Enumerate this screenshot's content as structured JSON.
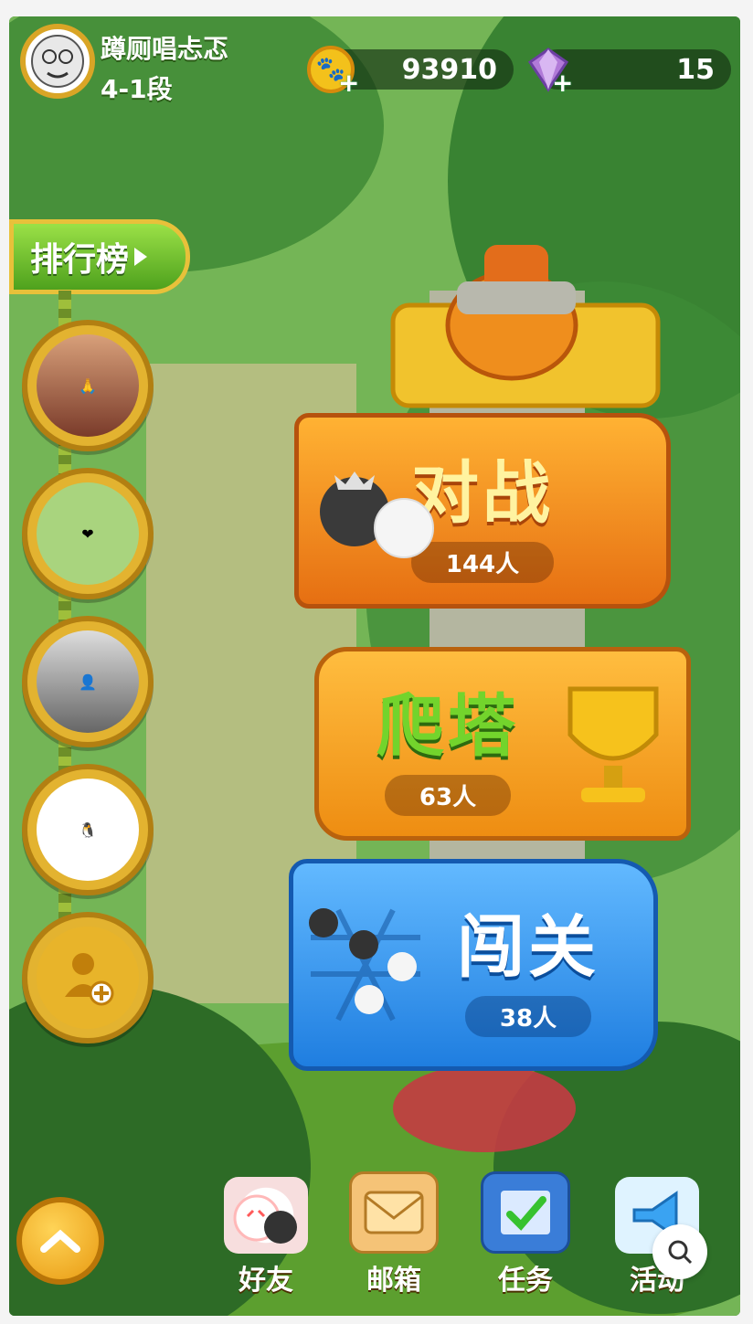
{
  "player": {
    "name": "蹲厕唱忐忑",
    "level": "4-1段"
  },
  "currency": {
    "coins": "93910",
    "gems": "15"
  },
  "leaderboard": {
    "label": "排行榜"
  },
  "modes": [
    {
      "title": "对战",
      "count": "144人"
    },
    {
      "title": "爬塔",
      "count": "63人"
    },
    {
      "title": "闯关",
      "count": "38人"
    }
  ],
  "nav": [
    {
      "label": "好友",
      "icon": "friends-icon"
    },
    {
      "label": "邮箱",
      "icon": "mail-icon"
    },
    {
      "label": "任务",
      "icon": "tasks-icon"
    },
    {
      "label": "活动",
      "icon": "horn-icon"
    }
  ],
  "colors": {
    "battle": "#f39a1c",
    "tower": "#f2a21b",
    "stage": "#2f8fe6",
    "tower_text": "#6fd12b",
    "stage_text": "#ffffff",
    "battle_text": "#fff2a8"
  }
}
